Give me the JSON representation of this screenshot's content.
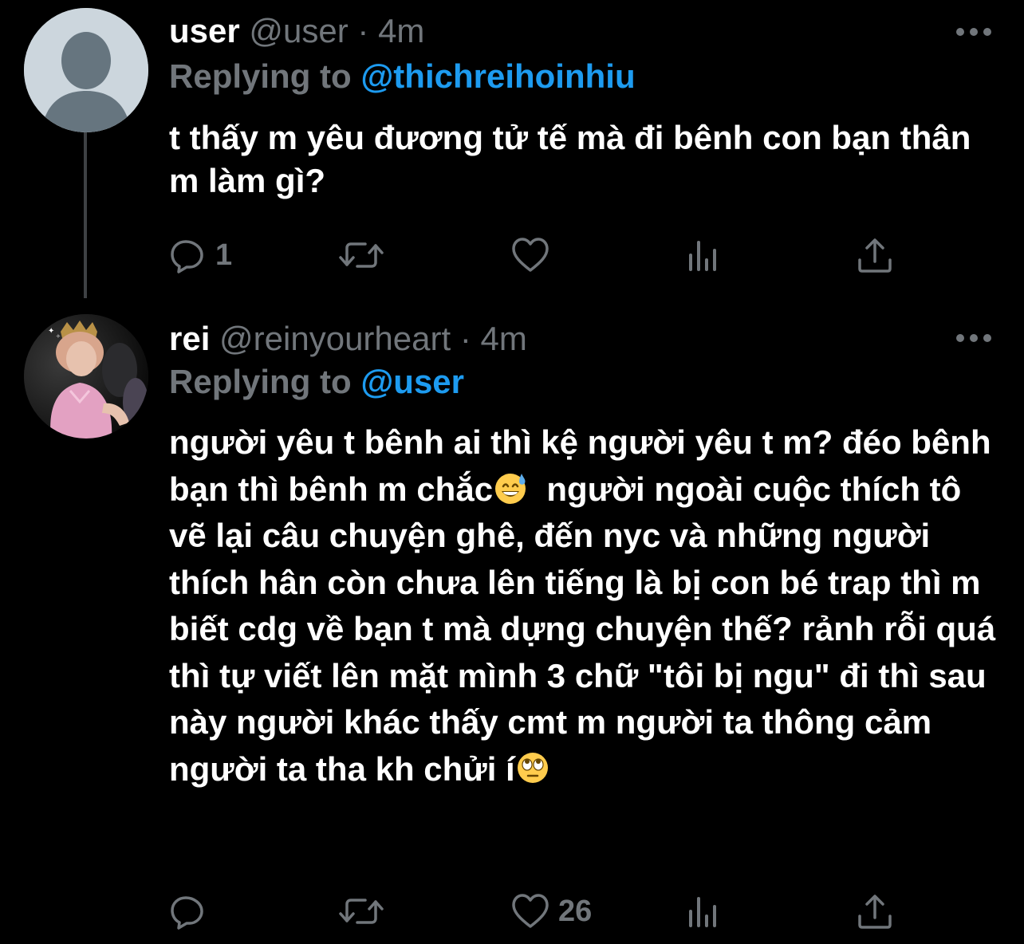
{
  "colors": {
    "background": "#000000",
    "text_primary": "#ffffff",
    "text_secondary": "#71767b",
    "link": "#1d9bf0",
    "thread_line": "#3e4144"
  },
  "tweets": [
    {
      "avatar": "default-profile-icon",
      "display_name": "user",
      "handle": "@user",
      "separator": "·",
      "time": "4m",
      "replying_prefix": "Replying to",
      "replying_to": "@thichreihoinhiu",
      "text": "t thấy m yêu đương tử tế mà đi bênh con bạn thân m làm gì?",
      "reply_count": "1",
      "retweet_count": "",
      "like_count": ""
    },
    {
      "avatar": "profile-photo",
      "display_name": "rei",
      "handle": "@reinyourheart",
      "separator": "·",
      "time": "4m",
      "replying_prefix": "Replying to",
      "replying_to": "@user",
      "text_part1": "người yêu t bênh ai thì kệ người yêu t m? đéo bênh bạn thì bênh m chắc",
      "emoji_1": "grinning-face-with-sweat-emoji",
      "text_part2": "  người ngoài cuộc thích tô vẽ lại câu chuyện ghê, đến nyc và những người thích hân còn chưa lên tiếng là bị con bé trap thì m biết cdg về bạn t mà dựng chuyện thế? rảnh rỗi quá thì tự viết lên mặt mình 3 chữ \"tôi bị ngu\" đi thì sau này người khác thấy cmt m người ta thông cảm người ta tha kh chửi í",
      "emoji_2": "face-with-rolling-eyes-emoji",
      "reply_count": "",
      "retweet_count": "",
      "like_count": "26"
    }
  ]
}
